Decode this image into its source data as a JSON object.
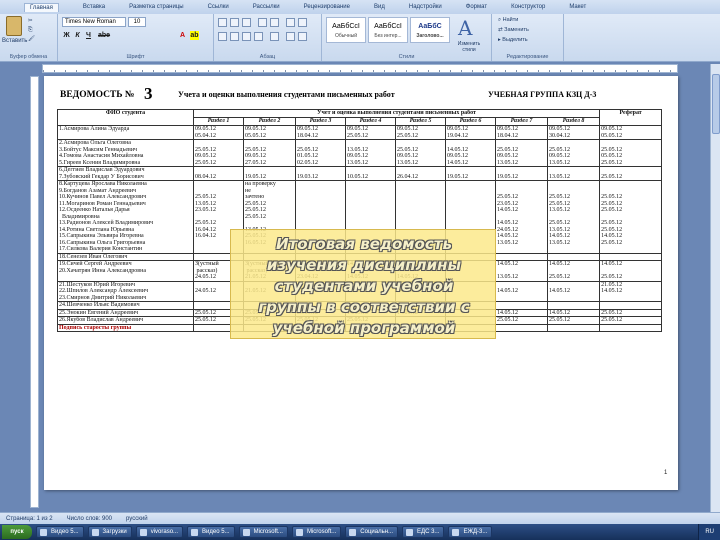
{
  "ribbon": {
    "tabs": [
      "Главная",
      "Вставка",
      "Разметка страницы",
      "Ссылки",
      "Рассылки",
      "Рецензирование",
      "Вид",
      "Надстройки",
      "Формат",
      "Конструктор",
      "Макет"
    ],
    "active_tab": "Главная",
    "groups": {
      "clipboard": "Буфер обмена",
      "font": "Шрифт",
      "paragraph": "Абзац",
      "styles": "Стили",
      "editing": "Редактирование"
    },
    "paste_label": "Вставить",
    "font_name": "Times New Roman",
    "font_size": "10",
    "style_samples": [
      {
        "sample": "АаБбСсI",
        "name": "Обычный"
      },
      {
        "sample": "АаБбСсI",
        "name": "Без интер..."
      },
      {
        "sample": "АаБбС",
        "name": "Заголово..."
      }
    ],
    "change_styles": "Изменить стили",
    "editing_items": [
      "Найти",
      "Заменить",
      "Выделить"
    ]
  },
  "document": {
    "title_word": "ВЕДОМОСТЬ №",
    "title_number": "3",
    "subtitle": "Учета и оценки выполнения студентами письменных работ",
    "group_label": "УЧЕБНАЯ ГРУППА  КЗЦ Д-3",
    "table": {
      "col_fio": "ФИО студента",
      "col_main": "Учет и оценка выполнения студентами письменных работ",
      "col_ref": "Реферат",
      "sections": [
        "Раздел 1",
        "Раздел 2",
        "Раздел 3",
        "Раздел 4",
        "Раздел 5",
        "Раздел 6",
        "Раздел 7",
        "Раздел 8"
      ],
      "rows": [
        [
          "1.Асмирова Алина Эдуарда",
          "09.05.12\n05.04.12",
          "09.05.12\n05.05.12",
          "09.05.12\n18.04.12",
          "09.05.12\n25.05.12",
          "09.05.12\n25.05.12",
          "09.05.12\n19.04.12",
          "09.05.12\n18.04.12",
          "09.05.12\n30.04.12",
          "09.05.12\n05.05.12"
        ],
        [
          "2.Асмирова Ольга Олеговна\n3.Бойтус Максим Геннадьевич\n4.Гомова Анастасия Михайловна\n5.Гиреев Ксения Владимировна",
          "\n25.05.12\n09.05.12\n25.05.12",
          "\n25.05.12\n09.05.12\n27.05.12",
          "\n25.05.12\n01.05.12\n02.05.12",
          "\n13.05.12\n09.05.12\n13.05.12",
          "\n25.05.12\n09.05.12\n13.05.12",
          "\n14.05.12\n09.05.12\n14.05.12",
          "\n25.05.12\n09.05.12\n13.05.12",
          "\n25.05.12\n09.05.12\n13.05.12",
          "\n25.05.12\n05.05.12\n25.05.12"
        ],
        [
          "6.Деггиев Владислав Эдуардович\n7.Зубовский Гекдар У Борисович",
          "\n08.04.12",
          "\n19.05.12",
          "\n19.03.12",
          "\n10.05.12",
          "\n26.04.12",
          "\n19.05.12",
          "\n19.05.12",
          "\n13.05.12",
          "\n25.05.12"
        ],
        [
          "8.Картуцева Ярослава Николаевна\n9.Богданов Азамат Андреевич\n10.Кучинов Павел Александрович\n11.Могаринов Роман Геннадьевич\n12.Осдеенко Наталья Дарья\n  Владимировна\n13.Радионов Алексей Владимирович\n14.Ротина Светлана Юрьевна\n15.Сапрыкина Эльвира Игоревна\n16.Сапрыкина Ольга Григорьевна\n17.Силкова Валерия Константин",
          "\n\n25.05.12\n13.05.12\n23.05.12\n\n25.05.12\n16.04.12\n16.04.12",
          "на проверку\nне\nзачтено\n25.05.12\n25.05.12\n25.05.12\n\n13.05.12\n25.05.12\n16.05.12",
          "\n\n\n\n\n\n\n\n",
          "",
          "",
          "",
          "\n\n25.05.12\n23.05.12\n14.05.12\n\n14.05.12\n24.05.12\n14.05.12\n13.05.12",
          "\n\n25.05.12\n25.05.12\n13.05.12\n\n25.05.12\n13.05.12\n14.05.12\n13.05.12",
          "\n\n25.05.12\n25.05.12\n25.05.12\n\n25.05.12\n25.05.12\n14.05.12\n25.05.12"
        ],
        [
          "18.Сенезев Иван Олегович",
          "",
          "",
          "",
          "",
          "",
          "",
          "",
          "",
          ""
        ],
        [
          "19.Сичей Сергей Андреевич\n20.Хачатрян Инна Александровна",
          "З(устный\n рассказ)\n24.05.12",
          "З(устный\n рассказ)\n21.05.12",
          "09.04.12\n\n23.04.12",
          "14.05.12\n\n14.05.12",
          "14.05.12\n\n14.05.12",
          "",
          "14.05.12\n\n13.05.12",
          "14.05.12\n\n25.05.12",
          "14.05.12\n\n25.05.12"
        ],
        [
          "21.Шестуков Юрий Игоревич\n22.Шпилов Александр Алексеевич\n23.Смирнов Дмитрий Николаевич",
          "\n24.05.12",
          "\n21.05.12",
          "\n21.05.12",
          "\n25.05.12",
          "\n14.05.12",
          "",
          "\n14.05.12",
          "\n14.05.12",
          "21.05.12\n14.05.12"
        ],
        [
          "24.Шевченко Ильяс Вадимович",
          "",
          "",
          "",
          "",
          "",
          "",
          "",
          "",
          ""
        ],
        [
          "25.Энокин Евгений Андреевич",
          "25.05.12",
          "25.05.12",
          "25.05.12",
          "14.05.12",
          "14.05.12",
          "",
          "14.05.12",
          "14.05.12",
          "25.05.12"
        ],
        [
          "26.Якубов Владислав Андреевич",
          "25.05.12",
          "25.05.12",
          "25.05.12",
          "25.05.12",
          "",
          "",
          "25.05.12",
          "25.05.12",
          "25.05.12"
        ]
      ],
      "signature": "Подпись старосты группы"
    },
    "page_number": "1"
  },
  "overlay_text": "Итоговая ведомость\nизучения дисциплины\nстудентами учебной\nгруппы в соответствии с\nучебной программой",
  "statusbar": {
    "page": "Страница: 1 из 2",
    "words": "Число слов: 900",
    "lang": "русский"
  },
  "taskbar": {
    "start": "пуск",
    "items": [
      "Видео 5...",
      "Загрузки",
      "vivoraso...",
      "Видео 5...",
      "Microsoft...",
      "Microsoft...",
      "Социальн...",
      "ЕДС 3...",
      "ЕЖД-3..."
    ],
    "tray": "RU"
  }
}
